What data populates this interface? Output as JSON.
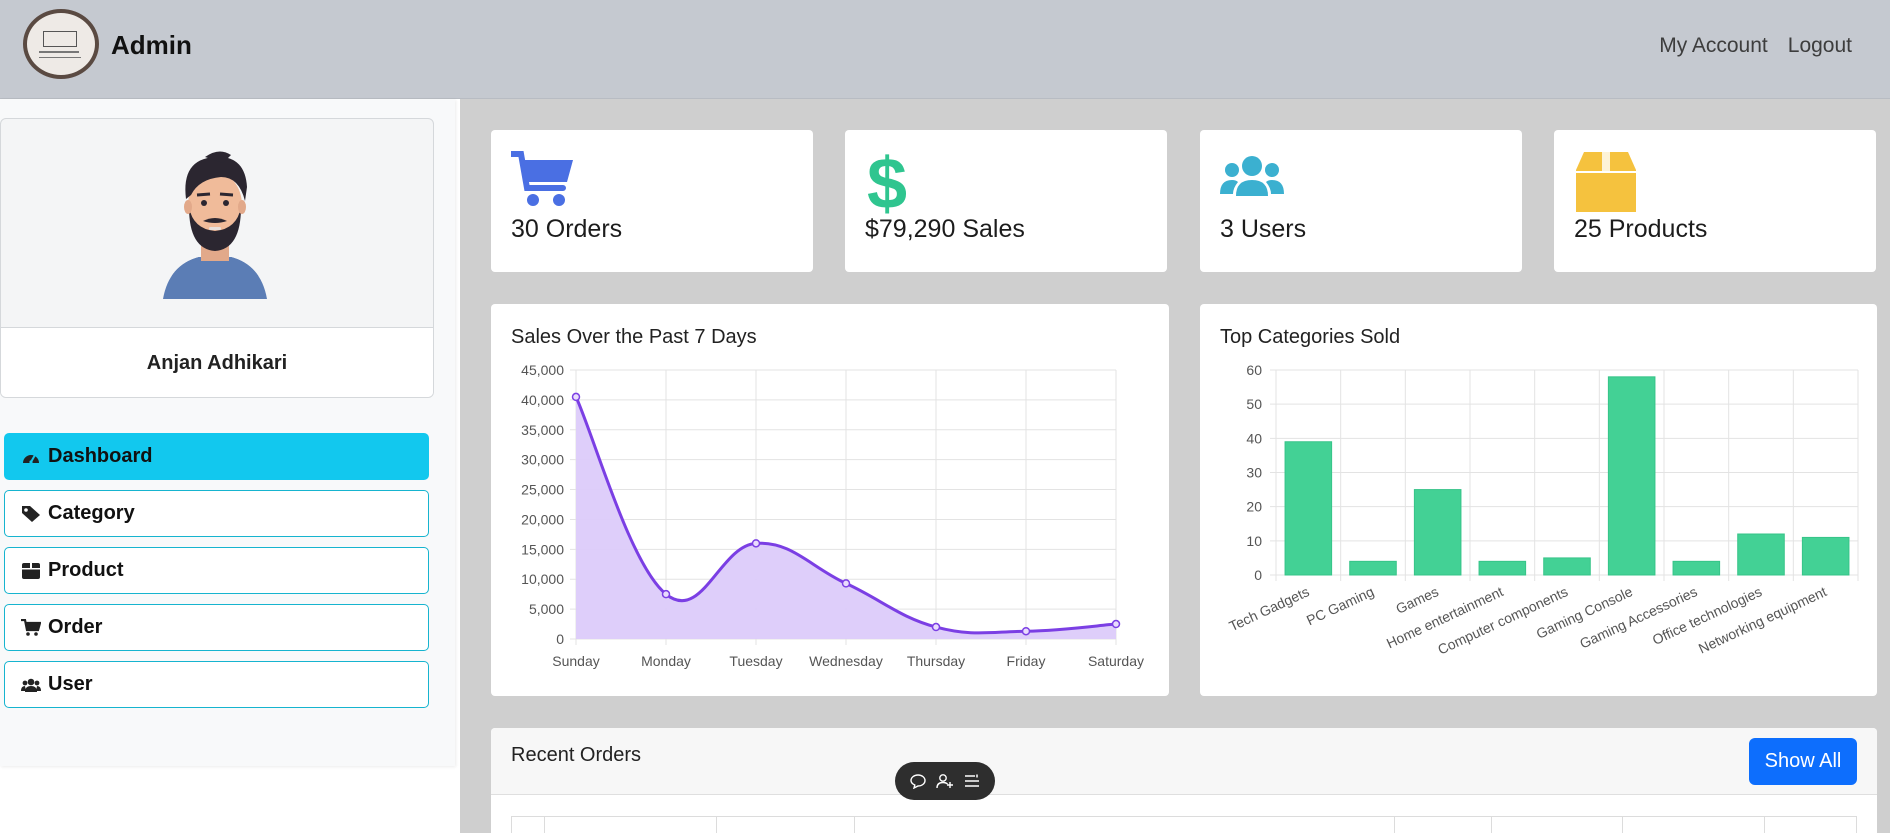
{
  "header": {
    "brand": "Admin",
    "nav": [
      "My Account",
      "Logout"
    ]
  },
  "profile": {
    "name": "Anjan Adhikari"
  },
  "sidebar": {
    "items": [
      {
        "label": "Dashboard",
        "icon": "gauge-icon",
        "active": true
      },
      {
        "label": "Category",
        "icon": "tag-icon",
        "active": false
      },
      {
        "label": "Product",
        "icon": "box-icon",
        "active": false
      },
      {
        "label": "Order",
        "icon": "cart-icon",
        "active": false
      },
      {
        "label": "User",
        "icon": "users-icon",
        "active": false
      }
    ]
  },
  "stats": [
    {
      "text": "30 Orders",
      "icon": "cart-icon",
      "color": "#4a6fe3"
    },
    {
      "text": "$79,290 Sales",
      "icon": "dollar-icon",
      "color": "#2fc58f"
    },
    {
      "text": "3 Users",
      "icon": "users-icon",
      "color": "#3bb0d0"
    },
    {
      "text": "25 Products",
      "icon": "box-icon",
      "color": "#f5c23e"
    }
  ],
  "chart_data": [
    {
      "type": "area",
      "title": "Sales Over the Past 7 Days",
      "categories": [
        "Sunday",
        "Monday",
        "Tuesday",
        "Wednesday",
        "Thursday",
        "Friday",
        "Saturday"
      ],
      "values": [
        40500,
        7500,
        16000,
        9300,
        2000,
        1300,
        2500
      ],
      "ylim": [
        0,
        45000
      ],
      "yticks": [
        "0",
        "5,000",
        "10,000",
        "15,000",
        "20,000",
        "25,000",
        "30,000",
        "35,000",
        "40,000",
        "45,000"
      ],
      "line_color": "#7b3fe4",
      "fill_color": "#dccbfa",
      "grid": true
    },
    {
      "type": "bar",
      "title": "Top Categories Sold",
      "categories": [
        "Tech Gadgets",
        "PC Gaming",
        "Games",
        "Home entertainment",
        "Computer components",
        "Gaming Console",
        "Gaming Accessories",
        "Office technologies",
        "Networking equipment"
      ],
      "values": [
        39,
        4,
        25,
        4,
        5,
        58,
        4,
        12,
        11
      ],
      "ylim": [
        0,
        60
      ],
      "yticks": [
        "0",
        "10",
        "20",
        "30",
        "40",
        "50",
        "60"
      ],
      "bar_color": "#43d195",
      "grid": true
    }
  ],
  "orders": {
    "title": "Recent Orders",
    "show_all": "Show All"
  }
}
